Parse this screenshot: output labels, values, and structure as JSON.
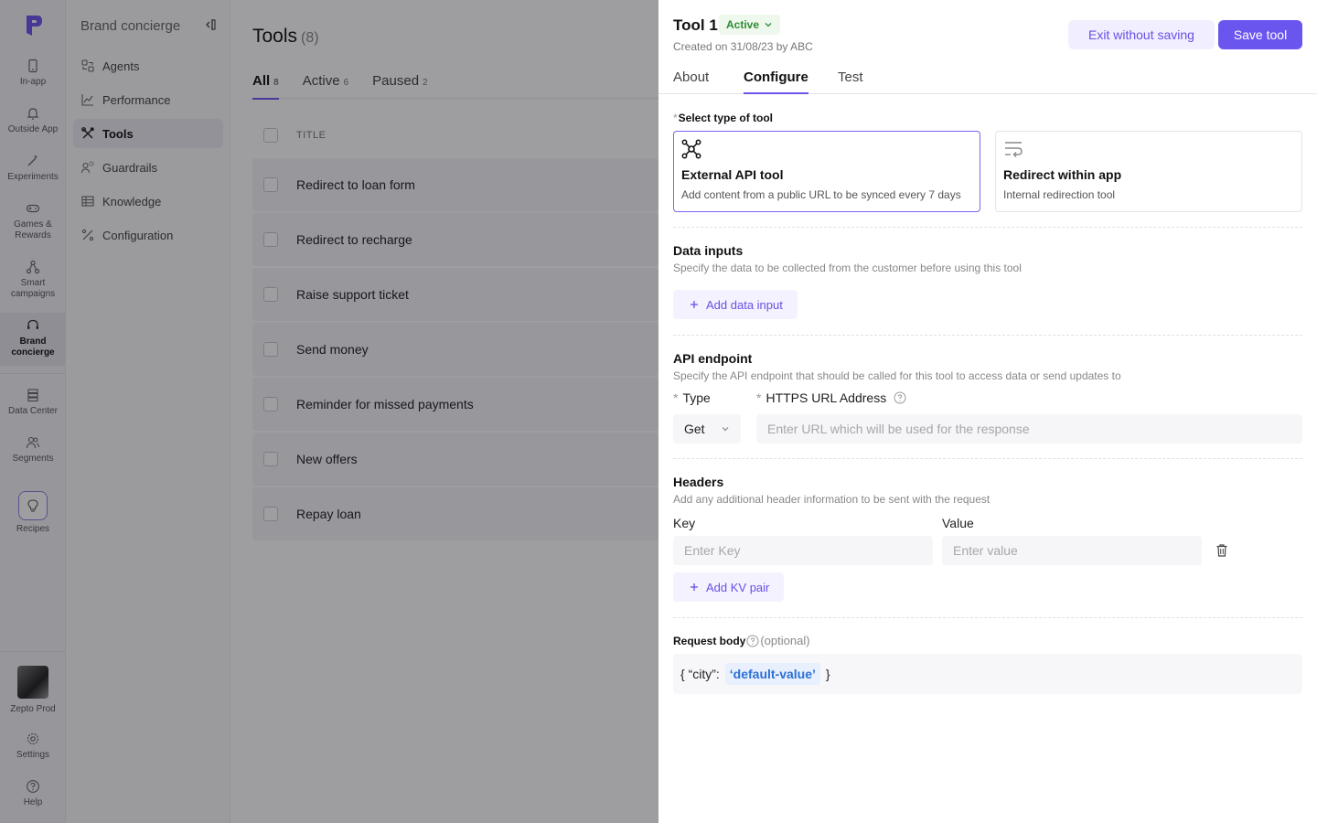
{
  "rail": {
    "items": [
      {
        "label": "In-app",
        "icon": "phone-icon"
      },
      {
        "label": "Outside App",
        "icon": "bell-icon"
      },
      {
        "label": "Experiments",
        "icon": "wand-icon"
      },
      {
        "label": "Games & Rewards",
        "icon": "gamepad-icon"
      },
      {
        "label": "Smart campaigns",
        "icon": "network-icon"
      },
      {
        "label": "Brand concierge",
        "icon": "headset-icon"
      },
      {
        "label": "Data Center",
        "icon": "database-icon"
      },
      {
        "label": "Segments",
        "icon": "users-icon"
      },
      {
        "label": "Recipes",
        "icon": "bulb-icon"
      },
      {
        "label": "Zepto Prod",
        "icon": "avatar"
      },
      {
        "label": "Settings",
        "icon": "gear-icon"
      },
      {
        "label": "Help",
        "icon": "help-icon"
      }
    ]
  },
  "subnav": {
    "title": "Brand concierge",
    "items": [
      {
        "label": "Agents"
      },
      {
        "label": "Performance"
      },
      {
        "label": "Tools"
      },
      {
        "label": "Guardrails"
      },
      {
        "label": "Knowledge"
      },
      {
        "label": "Configuration"
      }
    ]
  },
  "main": {
    "title": "Tools",
    "count": "(8)",
    "tabs": [
      {
        "label": "All",
        "badge": "8"
      },
      {
        "label": "Active",
        "badge": "6"
      },
      {
        "label": "Paused",
        "badge": "2"
      }
    ],
    "column_title": "TITLE",
    "rows": [
      "Redirect to loan form",
      "Redirect to recharge",
      "Raise support ticket",
      "Send money",
      "Reminder for missed payments",
      "New offers",
      "Repay loan"
    ]
  },
  "drawer": {
    "title": "Tool 1",
    "status": "Active",
    "created": "Created on 31/08/23 by ABC",
    "exit_label": "Exit without saving",
    "save_label": "Save tool",
    "tabs": [
      {
        "label": "About"
      },
      {
        "label": "Configure"
      },
      {
        "label": "Test"
      }
    ],
    "tool_type": {
      "label": "Select type of tool",
      "options": [
        {
          "title": "External API tool",
          "desc": "Add content from a public URL to be synced every 7 days",
          "icon": "api-network-icon"
        },
        {
          "title": "Redirect within app",
          "desc": "Internal redirection tool",
          "icon": "redirect-icon"
        }
      ]
    },
    "data_inputs": {
      "title": "Data inputs",
      "desc": "Specify the data to be collected from the customer before using this tool",
      "add_label": "Add data input"
    },
    "api_endpoint": {
      "title": "API endpoint",
      "desc": "Specify the API endpoint that should be called for this tool to access data or send updates to",
      "type_label": "Type",
      "type_value": "Get",
      "url_label": "HTTPS URL Address",
      "url_placeholder": "Enter URL which will be used for the response"
    },
    "headers": {
      "title": "Headers",
      "desc": "Add any additional header information to be sent with the request",
      "key_label": "Key",
      "value_label": "Value",
      "key_placeholder": "Enter Key",
      "value_placeholder": "Enter value",
      "add_label": "Add KV pair"
    },
    "request_body": {
      "label": "Request body",
      "optional": "(optional)",
      "prefix": "{ “city”:",
      "chip": "‘default-value’",
      "suffix": "}"
    }
  },
  "colors": {
    "accent": "#6b55ef",
    "active_status": "#2f8a35",
    "chip_text": "#2c6fd6"
  }
}
